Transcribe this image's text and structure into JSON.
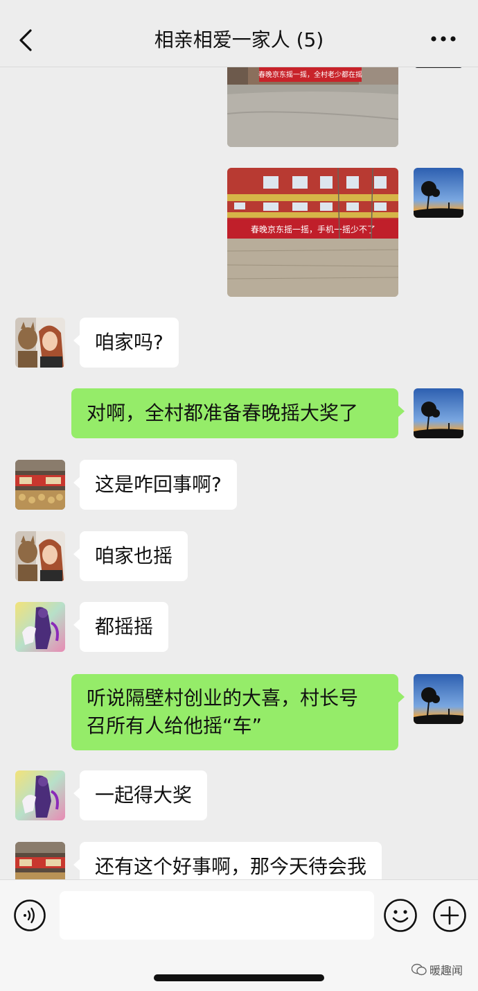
{
  "header": {
    "title": "相亲相爱一家人 (5)"
  },
  "photos": [
    {
      "sign_text": "春晚京东摇一摇，全村老少都在摇"
    },
    {
      "sign_text": "春晚京东摇一摇，手机一摇少不了"
    }
  ],
  "messages": [
    {
      "side": "in",
      "sender_avatar": "woman-with-cat-avatar",
      "text": "咱家吗?"
    },
    {
      "side": "out",
      "sender_avatar": "tree-sunset-avatar",
      "text": "对啊，全村都准备春晚摇大奖了"
    },
    {
      "side": "in",
      "sender_avatar": "food-shop-avatar",
      "text": "这是咋回事啊?"
    },
    {
      "side": "in",
      "sender_avatar": "woman-with-cat-avatar",
      "text": "咱家也摇"
    },
    {
      "side": "in",
      "sender_avatar": "purple-figure-avatar",
      "text": "都摇摇"
    },
    {
      "side": "out",
      "sender_avatar": "tree-sunset-avatar",
      "text_line1": "听说隔壁村创业的大喜，村长号",
      "text_line2": "召所有人给他摇“车”"
    },
    {
      "side": "in",
      "sender_avatar": "purple-figure-avatar",
      "text": "一起得大奖"
    },
    {
      "side": "in",
      "sender_avatar": "food-shop-avatar",
      "text": "还有这个好事啊，那今天待会我"
    }
  ],
  "input": {
    "value": "",
    "voice_icon": "voice-icon",
    "emoji_icon": "emoji-icon",
    "plus_icon": "plus-icon"
  },
  "watermark": {
    "text": "暖趣闻"
  },
  "colors": {
    "background": "#ededed",
    "outgoing_bubble": "#95ec69",
    "incoming_bubble": "#ffffff"
  }
}
